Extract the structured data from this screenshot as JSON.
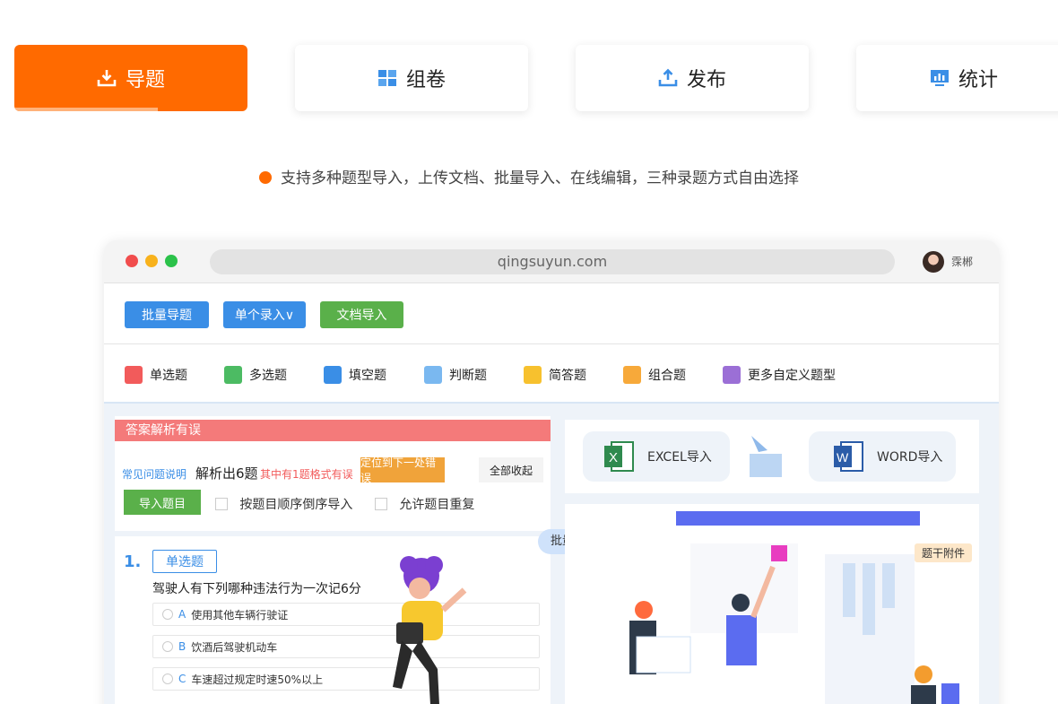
{
  "tabs": [
    {
      "label": "导题",
      "icon": "download-icon",
      "active": true
    },
    {
      "label": "组卷",
      "icon": "puzzle-icon",
      "active": false
    },
    {
      "label": "发布",
      "icon": "upload-icon",
      "active": false
    },
    {
      "label": "统计",
      "icon": "chart-icon",
      "active": false
    }
  ],
  "tagline": "支持多种题型导入，上传文档、批量导入、在线编辑，三种录题方式自由选择",
  "browser": {
    "url": "qingsuyun.com",
    "user_name": "霂郴"
  },
  "toolbar": {
    "batch_import": "批量导题",
    "single_entry": "单个录入∨",
    "doc_import": "文档导入"
  },
  "question_types": [
    {
      "label": "单选题",
      "icon": "single-choice-icon",
      "color": "#f25b5b"
    },
    {
      "label": "多选题",
      "icon": "multi-choice-icon",
      "color": "#4cbb63"
    },
    {
      "label": "填空题",
      "icon": "fill-blank-icon",
      "color": "#3a8ee6"
    },
    {
      "label": "判断题",
      "icon": "judge-icon",
      "color": "#7ab8f0"
    },
    {
      "label": "简答题",
      "icon": "short-answer-icon",
      "color": "#f7c12e"
    },
    {
      "label": "组合题",
      "icon": "combo-icon",
      "color": "#f7a93a"
    },
    {
      "label": "更多自定义题型",
      "icon": "custom-type-icon",
      "color": "#9b6fd6"
    }
  ],
  "parse_panel": {
    "error_title": "答案解析有误",
    "faq_link": "常见问题说明",
    "parsed_count": "解析出6题",
    "format_error": "其中有1题格式有误",
    "locate_btn": "定位到下一处错误",
    "collapse_btn": "全部收起",
    "import_btn": "导入题目",
    "reverse_order": "按题目顺序倒序导入",
    "allow_dup": "允许题目重复"
  },
  "question": {
    "number": "1.",
    "type": "单选题",
    "stem": "驾驶人有下列哪种违法行为一次记6分",
    "options": [
      {
        "letter": "A",
        "text": "使用其他车辆行驶证"
      },
      {
        "letter": "B",
        "text": "饮酒后驾驶机动车"
      },
      {
        "letter": "C",
        "text": "车速超过规定时速50%以上"
      }
    ]
  },
  "imports": {
    "excel": "EXCEL导入",
    "word": "WORD导入"
  },
  "knowledge_bubble": "批量设置知识点",
  "attachment_label": "题干附件",
  "colors": {
    "accent": "#ff6a00",
    "blue": "#3a8ee6",
    "green": "#5ab04a",
    "error": "#f47a7a"
  }
}
